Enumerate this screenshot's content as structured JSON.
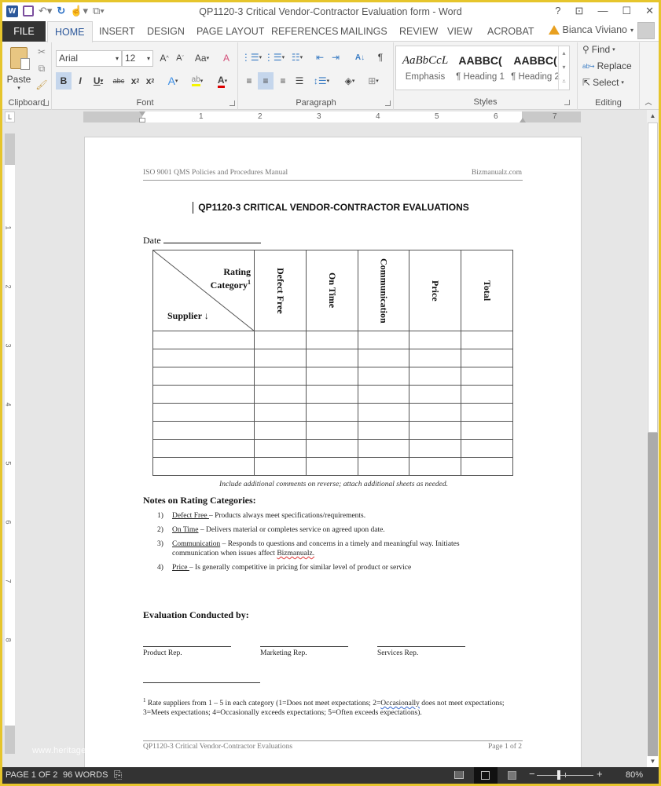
{
  "window": {
    "title": "QP1120-3 Critical Vendor-Contractor Evaluation form - Word",
    "controls": [
      "?",
      "ribbon-display",
      "minimize",
      "maximize",
      "close"
    ],
    "user": "Bianca Viviano"
  },
  "quick_access": [
    "word-icon",
    "save-icon",
    "undo-icon",
    "redo-icon",
    "touch-mode-icon",
    "customize-icon"
  ],
  "tabs": [
    "FILE",
    "HOME",
    "INSERT",
    "DESIGN",
    "PAGE LAYOUT",
    "REFERENCES",
    "MAILINGS",
    "REVIEW",
    "VIEW",
    "ACROBAT"
  ],
  "active_tab": "HOME",
  "ribbon": {
    "clipboard": {
      "label": "Clipboard",
      "paste": "Paste"
    },
    "font": {
      "label": "Font",
      "font_name": "Arial",
      "font_size": "12",
      "change_case": "Aa"
    },
    "paragraph": {
      "label": "Paragraph"
    },
    "styles": {
      "label": "Styles",
      "items": [
        {
          "preview": "AaBbCcL",
          "name": "Emphasis"
        },
        {
          "preview": "AABBC(",
          "name": "¶ Heading 1"
        },
        {
          "preview": "AABBC(",
          "name": "¶ Heading 2"
        }
      ]
    },
    "editing": {
      "label": "Editing",
      "find": "Find",
      "replace": "Replace",
      "select": "Select"
    }
  },
  "ruler": {
    "numbers": [
      "1",
      "2",
      "3",
      "4",
      "5",
      "6",
      "7"
    ],
    "tab_selector": "L"
  },
  "vruler": {
    "numbers": [
      "1",
      "2",
      "3",
      "4",
      "5",
      "6",
      "7",
      "8"
    ]
  },
  "document": {
    "header_left": "ISO 9001 QMS Policies and Procedures Manual",
    "header_right": "Bizmanualz.com",
    "title": "QP1120-3 CRITICAL VENDOR-CONTRACTOR EVALUATIONS",
    "date_label": "Date",
    "table": {
      "corner_top": "Rating",
      "corner_top2": "Category",
      "corner_sup": "1",
      "corner_bottom": "Supplier ↓",
      "columns": [
        "Defect Free",
        "On Time",
        "Communication",
        "Price",
        "Total"
      ],
      "body_rows": 8
    },
    "table_note": "Include additional comments on reverse; attach additional sheets as needed.",
    "notes_heading": "Notes on Rating Categories:",
    "notes": [
      {
        "num": "1)",
        "term": "Defect Free ",
        "text": "– Products always meet specifications/requirements."
      },
      {
        "num": "2)",
        "term": "On Time",
        "text": " – Delivers material or completes service on agreed upon date."
      },
      {
        "num": "3)",
        "term": "Communication",
        "text": " – Responds to questions and concerns in a timely and meaningful way.  Initiates communication when issues affect ",
        "tail": "Bizmanualz."
      },
      {
        "num": "4)",
        "term": "Price ",
        "text": "– Is generally competitive in pricing for similar level of product or service"
      }
    ],
    "eval_heading": "Evaluation Conducted by:",
    "signatures": [
      "Product Rep.",
      "Marketing Rep.",
      "Services Rep."
    ],
    "footnote_mark": "1",
    "footnote_a": " Rate suppliers from 1 – 5 in each category (1=Does not meet expectations; 2=",
    "footnote_b": "Occasionally",
    "footnote_c": " does not meet expectations; 3=Meets expectations; 4=Occasionally exceeds expectations; 5=Often exceeds expectations).",
    "footer_left": "QP1120-3 Critical Vendor-Contractor Evaluations",
    "footer_right": "Page 1 of 2"
  },
  "watermark": "www.heritage…",
  "status": {
    "page": "PAGE 1 OF 2",
    "words": "96 WORDS",
    "zoom": "80%",
    "zoom_percent": 80
  },
  "colors": {
    "word_blue": "#2b579a",
    "frame": "#e6c52c",
    "status_bg": "#333333"
  }
}
